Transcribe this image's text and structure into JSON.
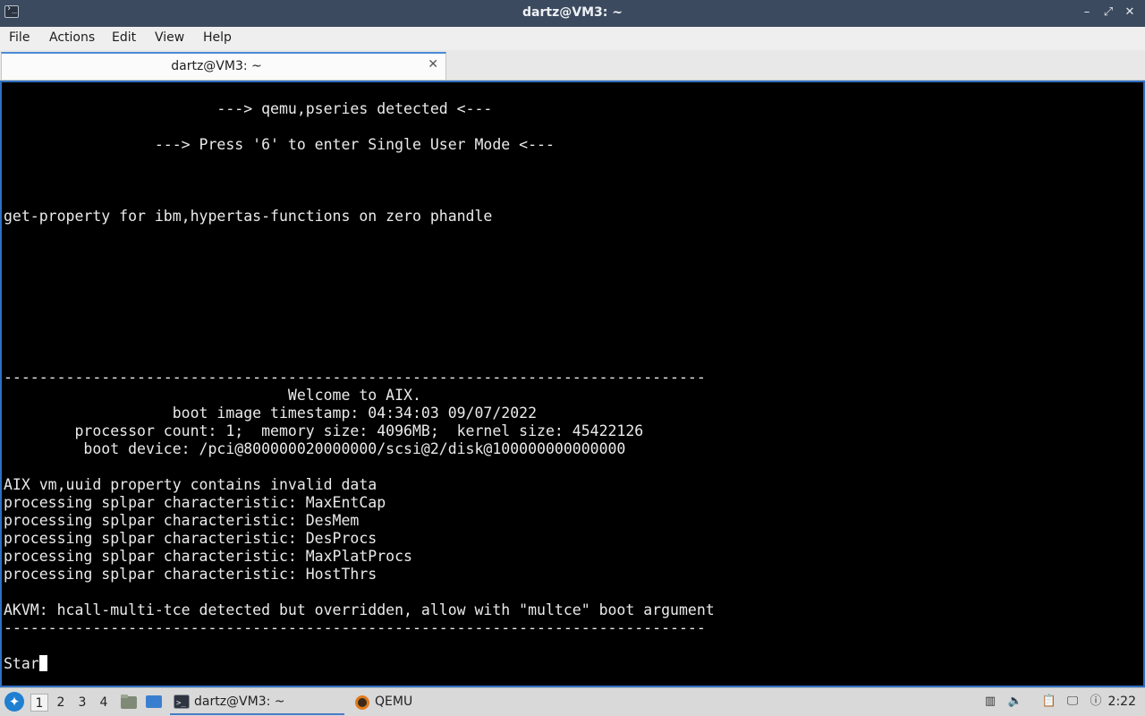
{
  "window": {
    "title": "dartz@VM3: ~",
    "controls": [
      "–",
      "⤢",
      "✕"
    ]
  },
  "menu": [
    "File",
    "Actions",
    "Edit",
    "View",
    "Help"
  ],
  "tab": {
    "label": "dartz@VM3: ~",
    "close": "✕"
  },
  "terminal": {
    "lines": [
      "                        ---> qemu,pseries detected <---",
      "                 ---> Press '6' to enter Single User Mode <---",
      "get-property for ibm,hypertas-functions on zero phandle",
      "-------------------------------------------------------------------------------",
      "                                Welcome to AIX.",
      "                   boot image timestamp: 04:34:03 09/07/2022",
      "        processor count: 1;  memory size: 4096MB;  kernel size: 45422126",
      "         boot device: /pci@800000020000000/scsi@2/disk@100000000000000",
      "AIX vm,uuid property contains invalid data",
      "processing splpar characteristic: MaxEntCap",
      "processing splpar characteristic: DesMem",
      "processing splpar characteristic: DesProcs",
      "processing splpar characteristic: MaxPlatProcs",
      "processing splpar characteristic: HostThrs",
      "AKVM: hcall-multi-tce detected but overridden, allow with \"multce\" boot argument",
      "-------------------------------------------------------------------------------",
      "Star"
    ]
  },
  "taskbar": {
    "workspaces": [
      "1",
      "2",
      "3",
      "4"
    ],
    "tasks": [
      {
        "label": "dartz@VM3: ~",
        "icon": "terminal-icon"
      },
      {
        "label": "QEMU",
        "icon": "qemu-icon"
      }
    ],
    "clock": "2:22"
  }
}
